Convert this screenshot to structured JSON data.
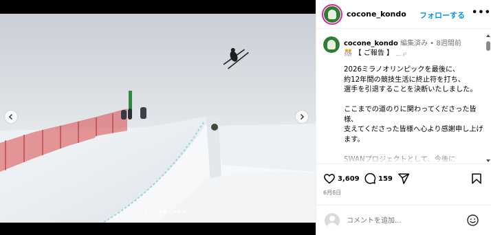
{
  "post": {
    "username": "cocone_kondo",
    "follow_label": "フォローする",
    "more_label": "•••"
  },
  "media": {
    "slide_count": 12,
    "active_slide": 7
  },
  "caption": {
    "username": "cocone_kondo",
    "edited": "編集済み",
    "separator": "•",
    "time_ago": "8週間前",
    "heading_emoji": "🎊",
    "heading": "【 ご報告 】",
    "heading_trail": "﹏ ℘",
    "body": "2026ミラノオリンピックを最後に、\n約12年間の競技生活に終止符を打ち、\n選手を引退することを決断いたしました。\n\nここまでの道のりに関わってくださった皆様、\n支えてくださった皆様へ心より感謝申し上げます。\n\nSWANプロジェクトとして、今後に"
  },
  "actions": {
    "likes": "3,609",
    "comments": "159"
  },
  "date": "6月8日",
  "comment_input": {
    "placeholder": "コメントを追加..."
  },
  "colors": {
    "follow_blue": "#0095f6",
    "avatar_ring": "#d6249f",
    "avatar_green": "#2e7d32"
  },
  "icons": {
    "like": "heart-icon",
    "comment": "comment-icon",
    "share": "paper-plane-icon",
    "save": "bookmark-icon",
    "emoji": "smiley-icon",
    "prev": "chevron-left-icon",
    "next": "chevron-right-icon"
  }
}
